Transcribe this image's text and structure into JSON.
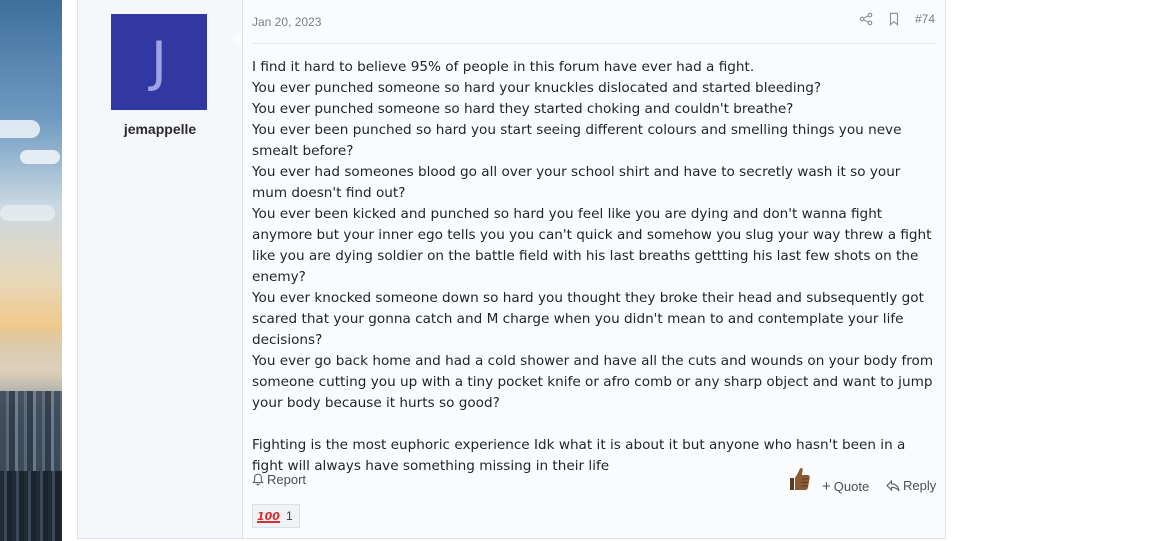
{
  "post": {
    "author": {
      "avatar_letter": "J",
      "avatar_color": "#3238a1",
      "username": "jemappelle"
    },
    "date": "Jan 20, 2023",
    "post_number": "#74",
    "header_icons": [
      "share-icon",
      "bookmark-icon"
    ],
    "body_lines": [
      "I find it hard to believe 95% of people in this forum have ever had a fight.",
      "You ever punched someone so hard your knuckles dislocated and started bleeding?",
      "You ever punched someone so hard they started choking and couldn't breathe?",
      "You ever been punched so hard you start seeing different colours and smelling things you neve smealt before?",
      "You ever had someones blood go all over your school shirt and have to secretly wash it so your mum doesn't find out?",
      "You ever been kicked and punched so hard you feel like you are dying and don't wanna fight anymore but your inner ego tells you you can't quick and somehow you slug your way threw a fight like you are dying soldier on the battle field with his last breaths gettting his last few shots on the enemy?",
      "You ever knocked someone down so hard you thought they broke their head and subsequently got scared that your gonna catch and M charge when you didn't mean to and contemplate your life decisions?",
      "You ever go back home and had a cold shower and have all the cuts and wounds on your body from someone cutting you up with a tiny pocket knife or afro comb or any sharp object and want to jump your body because it hurts so good?",
      "",
      "Fighting is the most euphoric experience Idk what it is about it but anyone who hasn't been in a fight will always have something missing in their life"
    ],
    "actions": {
      "report_label": "Report",
      "quote_label": "Quote",
      "reply_label": "Reply",
      "like_icon": "thumbs-up-icon"
    },
    "reactions": [
      {
        "icon": "hundred-points-icon",
        "glyph": "100",
        "count": "1"
      }
    ]
  }
}
